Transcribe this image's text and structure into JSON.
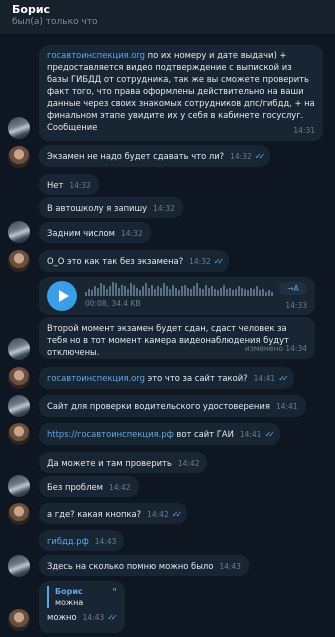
{
  "header": {
    "contact_name": "Борис",
    "status": "был(а) только что"
  },
  "messages": [
    {
      "id": "m1",
      "parts": [
        {
          "text": "госавтоинспекция.org",
          "link": true
        },
        {
          "text": " по их номеру и дате выдачи) + предоставляется видео подтверждение с выпиской из базы ГИБДД от сотрудника, так же вы сможете проверить факт того, что права оформлены действительно на ваши данные через своих знакомых сотрудников дпс/гибдд, + на финальном этапе увидите их у себя в кабинете госуслуг."
        },
        {
          "text": " Сообщение"
        }
      ],
      "time": "14:31"
    },
    {
      "id": "m2",
      "text": "Экзамен не надо будет сдавать что ли?",
      "time": "14:32",
      "read": true
    },
    {
      "id": "m3",
      "text": "Нет",
      "time": "14:32"
    },
    {
      "id": "m4",
      "text": "В автошколу я запишу",
      "time": "14:32"
    },
    {
      "id": "m5",
      "text": "Задним числом",
      "time": "14:32"
    },
    {
      "id": "m6",
      "text": "О_О это как так без экзамена?",
      "time": "14:32",
      "read": true
    },
    {
      "id": "m7",
      "voice": {
        "elapsed": "00:08, 34.4 KB",
        "button": "→A"
      },
      "time": "14:33"
    },
    {
      "id": "m8",
      "text": "Второй момент экзамен будет сдан, сдаст человек за тебя но в тот момент камера видеонаблюдения будут отключены.",
      "edited": "изменено",
      "time": "14:34"
    },
    {
      "id": "m9",
      "link_text": "госавтоинспекция.org",
      "text": " это что за сайт такой?",
      "time": "14:41",
      "read": true
    },
    {
      "id": "m10",
      "text": "Сайт для проверки водительского удостоверения",
      "time": "14:41"
    },
    {
      "id": "m11",
      "link_text": "https://госавтоинспекция.рф",
      "text": " вот сайт ГАИ",
      "time": "14:41",
      "read": true
    },
    {
      "id": "m12",
      "text": "Да можете и там проверить",
      "time": "14:42"
    },
    {
      "id": "m13",
      "text": "Без проблем",
      "time": "14:42"
    },
    {
      "id": "m14",
      "text": "а где? какая кнопка?",
      "time": "14:42",
      "read": true
    },
    {
      "id": "m15",
      "link_text": "гибдд.рф",
      "time": "14:43"
    },
    {
      "id": "m16",
      "text": "Здесь на сколько помню можно было",
      "time": "14:43"
    },
    {
      "id": "m17",
      "quote": {
        "author": "Борис",
        "text": "можна"
      },
      "text": "можно",
      "time": "14:43",
      "read": true
    }
  ],
  "voice_levels": [
    0.3,
    0.5,
    0.4,
    0.7,
    0.6,
    0.9,
    0.8,
    0.5,
    0.7,
    1.0,
    0.9,
    0.6,
    0.8,
    0.7,
    0.5,
    0.9,
    0.8,
    0.6,
    0.4,
    0.7,
    0.9,
    0.6,
    0.8,
    0.5,
    0.7,
    0.6,
    0.9,
    0.7,
    0.5,
    0.8,
    0.6,
    0.4,
    0.7,
    0.8,
    0.6,
    0.5,
    0.7,
    0.9,
    0.6,
    0.5,
    0.8,
    0.6,
    0.7,
    0.5,
    0.4,
    0.6,
    0.8,
    0.5,
    0.6,
    0.4,
    0.5,
    0.7,
    0.6,
    0.5,
    0.4,
    0.6,
    0.5,
    0.7,
    0.4,
    0.5,
    0.3,
    0.4,
    0.3
  ],
  "colors": {
    "background": "#0e1621",
    "bubble": "#182533",
    "link": "#5fa8e8",
    "accent": "#3b9ee8"
  }
}
